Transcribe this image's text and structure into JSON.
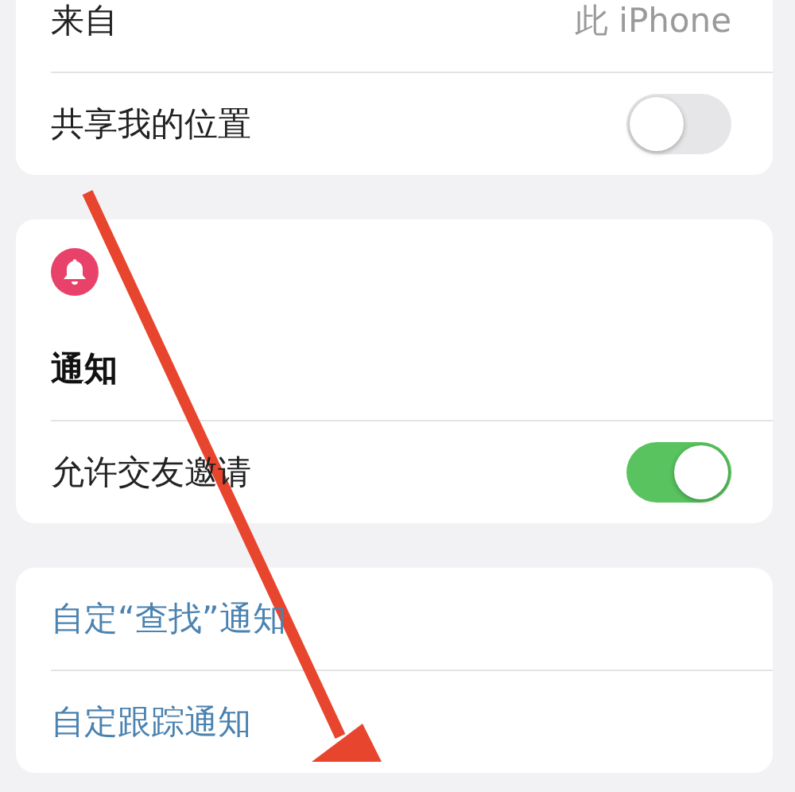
{
  "groups": [
    {
      "rows": [
        {
          "kind": "value",
          "label": "来自",
          "value": "此 iPhone"
        },
        {
          "kind": "toggle",
          "label": "共享我的位置",
          "on": false
        }
      ]
    },
    {
      "header": {
        "title": "通知"
      },
      "rows": [
        {
          "kind": "toggle",
          "label": "允许交友邀请",
          "on": true
        }
      ]
    },
    {
      "rows": [
        {
          "kind": "link",
          "label": "自定“查找”通知"
        },
        {
          "kind": "link",
          "label": "自定跟踪通知"
        }
      ]
    }
  ],
  "annotation": {
    "kind": "arrow",
    "color": "#e8452f"
  }
}
